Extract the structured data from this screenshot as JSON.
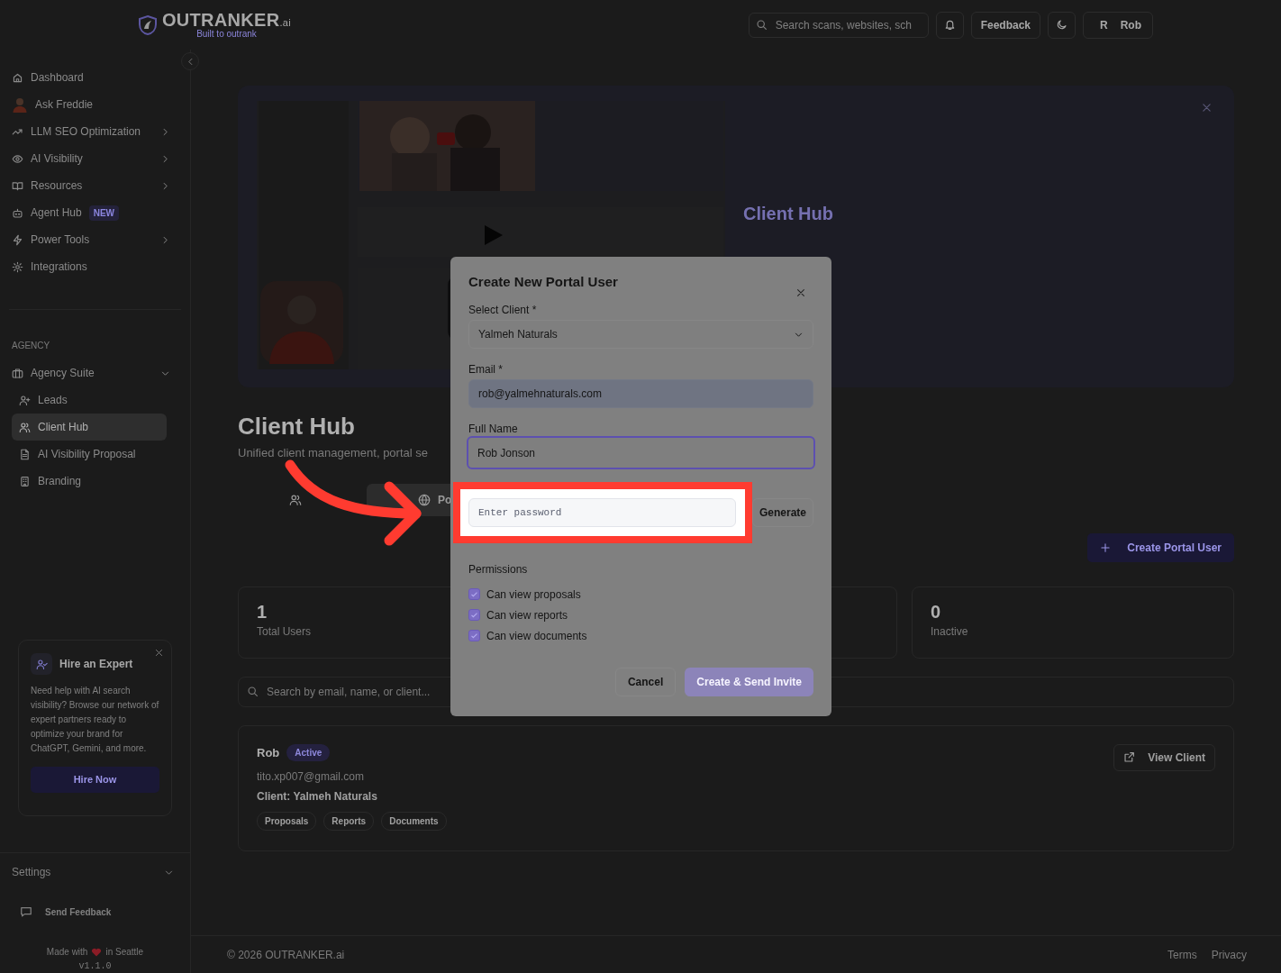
{
  "header": {
    "logo": {
      "wordmark": "OUTRANKER$_{.ai}$",
      "tagline": "Built to outrank"
    },
    "search": {
      "placeholder": "Search scans, websites, sch"
    },
    "feedback": "Feedback",
    "user": {
      "initial": "R",
      "name": "Rob"
    }
  },
  "sidebar": {
    "items": [
      {
        "label": "Dashboard",
        "submenu": false,
        "selected": false
      },
      {
        "label": "Ask Freddie",
        "submenu": false,
        "selected": false
      },
      {
        "label": "LLM SEO Optimization",
        "submenu": true,
        "selected": false
      },
      {
        "label": "AI Visibility",
        "submenu": true,
        "selected": false
      },
      {
        "label": "Resources",
        "submenu": true,
        "selected": false
      },
      {
        "label": "Agent Hub",
        "submenu": false,
        "selected": false,
        "badge": "NEW"
      },
      {
        "label": "Power Tools",
        "submenu": true,
        "selected": false
      },
      {
        "label": "Integrations",
        "submenu": false,
        "selected": false
      }
    ],
    "section_label": "AGENCY",
    "agency": {
      "label": "Agency Suite",
      "expanded": true,
      "children": [
        {
          "label": "Leads",
          "selected": false
        },
        {
          "label": "Client Hub",
          "selected": true
        },
        {
          "label": "AI Visibility Proposal",
          "selected": false
        },
        {
          "label": "Branding",
          "selected": false
        }
      ]
    },
    "promo": {
      "title": "Hire an Expert",
      "text": "Need help with AI search visibility? Browse our network of expert partners ready to optimize your brand for ChatGPT, Gemini, and more.",
      "button": "Hire Now"
    },
    "settings": "Settings",
    "send_feedback": "Send Feedback",
    "made_with": {
      "before": "Made with",
      "after": "in Seattle"
    },
    "version": "v1.1.0"
  },
  "banner": {
    "title": "Client Hub"
  },
  "page": {
    "title": "Client Hub",
    "subtitle": "Unified client management, portal se",
    "tabs": [
      {
        "selected": false
      },
      {
        "label": "Po",
        "selected": true
      }
    ],
    "create_button": "Create Portal User",
    "stats": [
      {
        "kind": "stat",
        "value": "1",
        "label": "Total Users"
      },
      {
        "kind": "covered"
      },
      {
        "kind": "stat",
        "value": "0",
        "label": "Inactive"
      }
    ],
    "search": {
      "placeholder": "Search by email, name, or client..."
    },
    "users": [
      {
        "name": "Rob",
        "status": "Active",
        "email": "tito.xp007@gmail.com",
        "client": "Client: Yalmeh Naturals",
        "permissions": [
          "Proposals",
          "Reports",
          "Documents"
        ],
        "action": "View Client"
      }
    ]
  },
  "footer": {
    "copyright": "© 2026 OUTRANKER.ai",
    "links": [
      "Terms",
      "Privacy"
    ]
  },
  "modal": {
    "title": "Create New Portal User",
    "fields": [
      {
        "kind": "select",
        "label": "Select Client *",
        "value": "Yalmeh Naturals",
        "focused": false
      },
      {
        "kind": "autofill",
        "label": "Email *",
        "value": "rob@yalmehnaturals.com",
        "focused": false
      },
      {
        "kind": "text",
        "label": "Full Name",
        "value": "Rob Jonson",
        "focused": true
      },
      {
        "kind": "password",
        "placeholder": "Enter password",
        "button": "Generate",
        "highlighted": true
      }
    ],
    "permissions_label": "Permissions",
    "permissions": [
      {
        "label": "Can view proposals",
        "checked": true
      },
      {
        "label": "Can view reports",
        "checked": true
      },
      {
        "label": "Can view documents",
        "checked": true
      }
    ],
    "buttons": [
      {
        "label": "Cancel",
        "kind": "secondary",
        "disabled": false
      },
      {
        "label": "Create & Send Invite",
        "kind": "primary",
        "disabled": true
      }
    ]
  }
}
